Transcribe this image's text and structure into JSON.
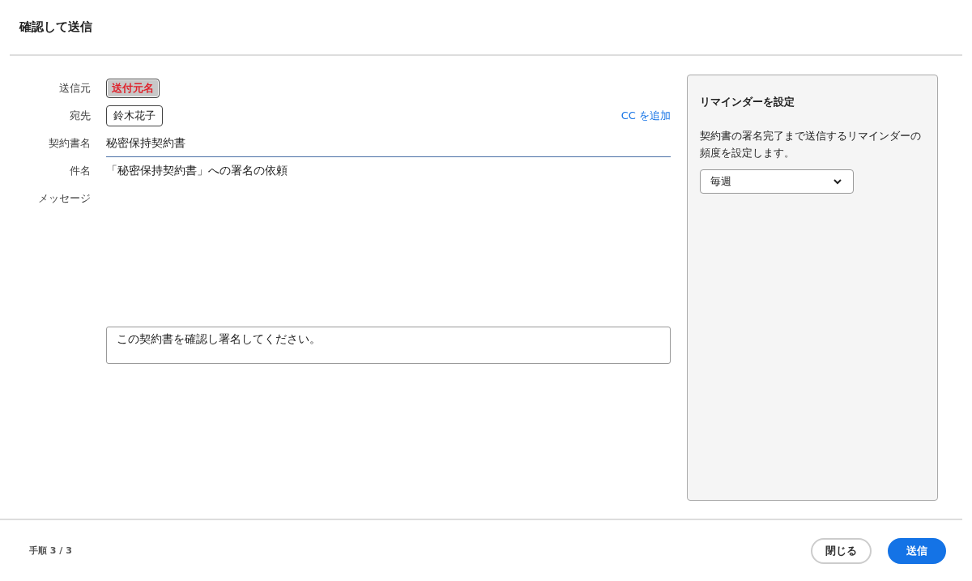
{
  "dialog": {
    "title": "確認して送信"
  },
  "form": {
    "cc_link": "CC を追加",
    "fields": [
      {
        "label": "送信元",
        "kind": "chip_highlight",
        "value": "送付元名"
      },
      {
        "label": "宛先",
        "kind": "chip",
        "value": "鈴木花子"
      },
      {
        "label": "契約書名",
        "kind": "input",
        "value": "秘密保持契約書"
      },
      {
        "label": "件名",
        "kind": "text",
        "value": "「秘密保持契約書」への署名の依頼"
      },
      {
        "label": "メッセージ",
        "kind": "textarea",
        "value": "この契約書を確認し署名してください。"
      }
    ]
  },
  "reminder": {
    "title": "リマインダーを設定",
    "description": "契約書の署名完了まで送信するリマインダーの頻度を設定します。",
    "frequency": "毎週"
  },
  "footer": {
    "step": "手順 3 / 3",
    "buttons": [
      {
        "label": "閉じる",
        "kind": "secondary"
      },
      {
        "label": "送信",
        "kind": "primary"
      }
    ]
  }
}
